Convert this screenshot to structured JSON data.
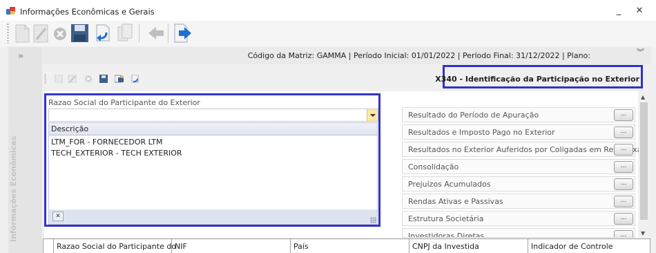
{
  "window": {
    "title": "Informações Econômicas e Gerais",
    "minimize_glyph": "_",
    "close_glyph": "✕"
  },
  "toolbar": {
    "buttons": [
      "new-document-icon",
      "edit-icon",
      "delete-icon",
      "save-icon",
      "undo-icon",
      "copy-icon",
      "back-arrow-icon",
      "forward-page-icon"
    ]
  },
  "left_panel": {
    "expand_glyph": "»",
    "vertical_label": "Informações Econômicas"
  },
  "header": {
    "info": "Código da Matriz: GAMMA | Período Inicial: 01/01/2022 | Período Final: 31/12/2022 | Plano:",
    "collapse_glyph": "︾"
  },
  "section": {
    "title": "X340 - Identificação da Participação no Exterior"
  },
  "participant_field": {
    "label": "Razao Social do Participante do Exterior",
    "value": "",
    "dropdown": {
      "column_header": "Descrição",
      "items": [
        "LTM_FOR - FORNECEDOR LTM",
        "TECH_EXTERIOR - TECH EXTERIOR"
      ],
      "clear_glyph": "✕"
    }
  },
  "side_options": {
    "button_label": "...",
    "items": [
      "Resultado do Período de Apuração",
      "Resultados e Imposto Pago no Exterior",
      "Resultados no Exterior Auferidos por Coligadas em Reg.Caixa",
      "Consolidação",
      "Prejuízos Acumulados",
      "Rendas Ativas e Passivas",
      "Estrutura Societária",
      "Investidoras Diretas"
    ]
  },
  "grid": {
    "columns": [
      "Razao Social do Participante do",
      "NIF",
      "País",
      "CNPJ da Investida",
      "Indicador de Controle"
    ]
  },
  "colors": {
    "highlight_border": "#3232c8",
    "dropdown_arrow_bg": "#fbe8a6"
  }
}
